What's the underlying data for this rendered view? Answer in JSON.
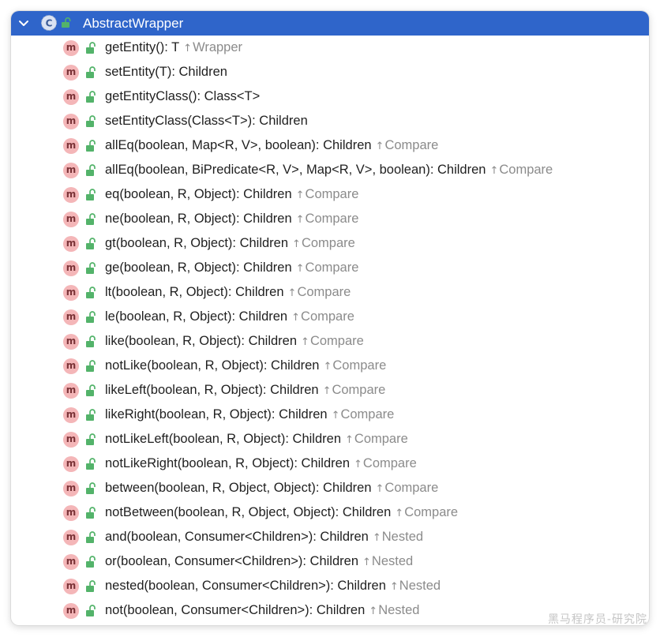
{
  "header": {
    "class_name": "AbstractWrapper",
    "class_icon_letter": "C",
    "expanded": true,
    "accent_color": "#2f65ca"
  },
  "method_icon_letter": "m",
  "methods": [
    {
      "signature": "getEntity(): T",
      "origin": "Wrapper"
    },
    {
      "signature": "setEntity(T): Children",
      "origin": ""
    },
    {
      "signature": "getEntityClass(): Class<T>",
      "origin": ""
    },
    {
      "signature": "setEntityClass(Class<T>): Children",
      "origin": ""
    },
    {
      "signature": "allEq(boolean, Map<R, V>, boolean): Children",
      "origin": "Compare"
    },
    {
      "signature": "allEq(boolean, BiPredicate<R, V>, Map<R, V>, boolean): Children",
      "origin": "Compare"
    },
    {
      "signature": "eq(boolean, R, Object): Children",
      "origin": "Compare"
    },
    {
      "signature": "ne(boolean, R, Object): Children",
      "origin": "Compare"
    },
    {
      "signature": "gt(boolean, R, Object): Children",
      "origin": "Compare"
    },
    {
      "signature": "ge(boolean, R, Object): Children",
      "origin": "Compare"
    },
    {
      "signature": "lt(boolean, R, Object): Children",
      "origin": "Compare"
    },
    {
      "signature": "le(boolean, R, Object): Children",
      "origin": "Compare"
    },
    {
      "signature": "like(boolean, R, Object): Children",
      "origin": "Compare"
    },
    {
      "signature": "notLike(boolean, R, Object): Children",
      "origin": "Compare"
    },
    {
      "signature": "likeLeft(boolean, R, Object): Children",
      "origin": "Compare"
    },
    {
      "signature": "likeRight(boolean, R, Object): Children",
      "origin": "Compare"
    },
    {
      "signature": "notLikeLeft(boolean, R, Object): Children",
      "origin": "Compare"
    },
    {
      "signature": "notLikeRight(boolean, R, Object): Children",
      "origin": "Compare"
    },
    {
      "signature": "between(boolean, R, Object, Object): Children",
      "origin": "Compare"
    },
    {
      "signature": "notBetween(boolean, R, Object, Object): Children",
      "origin": "Compare"
    },
    {
      "signature": "and(boolean, Consumer<Children>): Children",
      "origin": "Nested"
    },
    {
      "signature": "or(boolean, Consumer<Children>): Children",
      "origin": "Nested"
    },
    {
      "signature": "nested(boolean, Consumer<Children>): Children",
      "origin": "Nested"
    },
    {
      "signature": "not(boolean, Consumer<Children>): Children",
      "origin": "Nested"
    }
  ],
  "watermark": "黑马程序员-研究院"
}
